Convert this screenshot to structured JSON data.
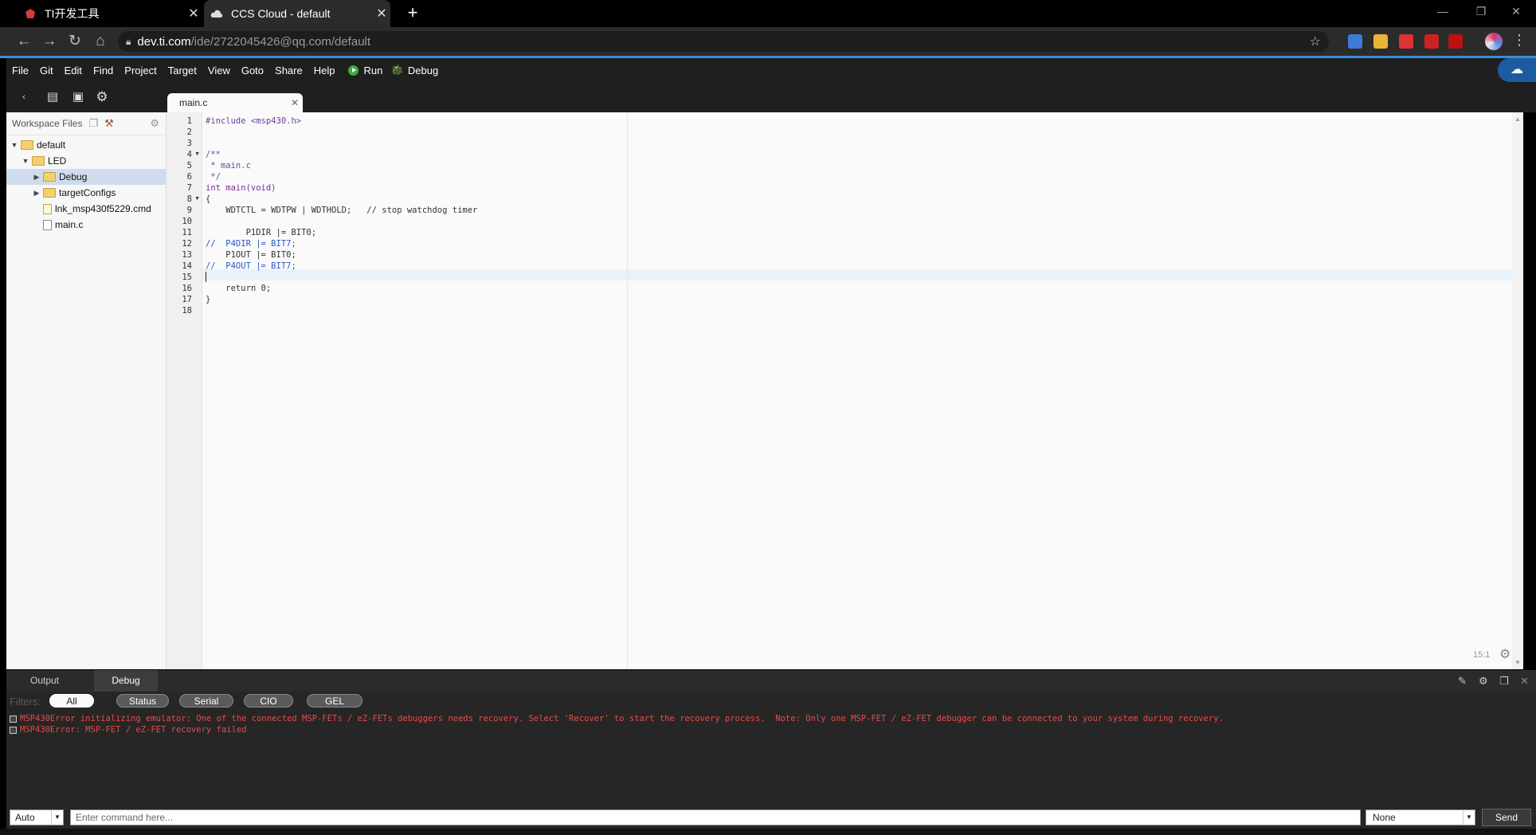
{
  "browser": {
    "tabs": [
      {
        "title": "TI开发工具"
      },
      {
        "title": "CCS Cloud - default"
      }
    ],
    "url_host": "dev.ti.com",
    "url_path": "/ide/2722045426@qq.com/default"
  },
  "menu": {
    "items": [
      "File",
      "Git",
      "Edit",
      "Find",
      "Project",
      "Target",
      "View",
      "Goto",
      "Share",
      "Help"
    ],
    "run_label": "Run",
    "debug_label": "Debug"
  },
  "editor_tab": {
    "label": "main.c"
  },
  "sidebar": {
    "title": "Workspace Files",
    "tree": [
      {
        "label": "default",
        "level": 0,
        "type": "folder",
        "expanded": true
      },
      {
        "label": "LED",
        "level": 1,
        "type": "folder",
        "expanded": true
      },
      {
        "label": "Debug",
        "level": 2,
        "type": "folder",
        "expanded": false,
        "selected": true
      },
      {
        "label": "targetConfigs",
        "level": 2,
        "type": "folder",
        "expanded": false
      },
      {
        "label": "lnk_msp430f5229.cmd",
        "level": 2,
        "type": "cmd"
      },
      {
        "label": "main.c",
        "level": 2,
        "type": "file"
      }
    ]
  },
  "code": {
    "lines": [
      "#include <msp430.h>",
      "",
      "",
      "/**",
      " * main.c",
      " */",
      "int main(void)",
      "{",
      "    WDTCTL = WDTPW | WDTHOLD;   // stop watchdog timer",
      "",
      "        P1DIR |= BIT0;",
      "//  P4DIR |= BIT7;",
      "    P1OUT |= BIT0;",
      "//  P4OUT |= BIT7;",
      "",
      "    return 0;",
      "}",
      ""
    ],
    "current_line": 15,
    "cursor_position": "15:1"
  },
  "bottom_panel": {
    "tabs": [
      "Output",
      "Debug"
    ],
    "active_tab": "Debug",
    "filters_label": "Filters:",
    "filters": [
      "All",
      "Status",
      "Serial",
      "CIO",
      "GEL"
    ],
    "active_filter": "All",
    "messages": [
      "MSP430Error initializing emulator: One of the connected MSP-FETs / eZ-FETs debuggers needs recovery. Select 'Recover' to start the recovery process.  Note: Only one MSP-FET / eZ-FET debugger can be connected to your system during recovery.",
      "MSP430Error: MSP-FET / eZ-FET recovery failed"
    ],
    "mode_select": "Auto",
    "command_placeholder": "Enter command here...",
    "target_select": "None",
    "send_label": "Send"
  },
  "colors": {
    "error_text": "#e84a4a",
    "run_green": "#3cab3c",
    "accent_blue": "#3a8fd9"
  }
}
